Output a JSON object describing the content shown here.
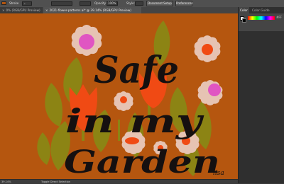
{
  "control_bar": {
    "stroke_label": "Stroke",
    "opacity_label": "Opacity:",
    "opacity_value": "100%",
    "style_label": "Style:",
    "document_setup_label": "Document Setup",
    "preferences_label": "Preferences"
  },
  "tabs": [
    {
      "close": "×",
      "label": "0% (RGB/GPU Preview)"
    },
    {
      "close": "×",
      "label": "2021-flower-patterns.ai* @ 39.14% (RGB/GPU Preview)"
    }
  ],
  "artwork": {
    "line1": "Safe",
    "line2": "in my",
    "line3": "Garden",
    "signature": "lisa"
  },
  "status_bar": {
    "zoom": "39.14%",
    "tool": "Toggle Direct Selection"
  },
  "panel": {
    "tabs": [
      "Color",
      "Color Guide"
    ],
    "hex": "#FF"
  },
  "colors": {
    "canvas": "#b5560f",
    "petal": "#e6c3b3",
    "orange": "#f04a14",
    "olive": "#8c8414",
    "pink": "#e055c2",
    "text": "#151010"
  }
}
